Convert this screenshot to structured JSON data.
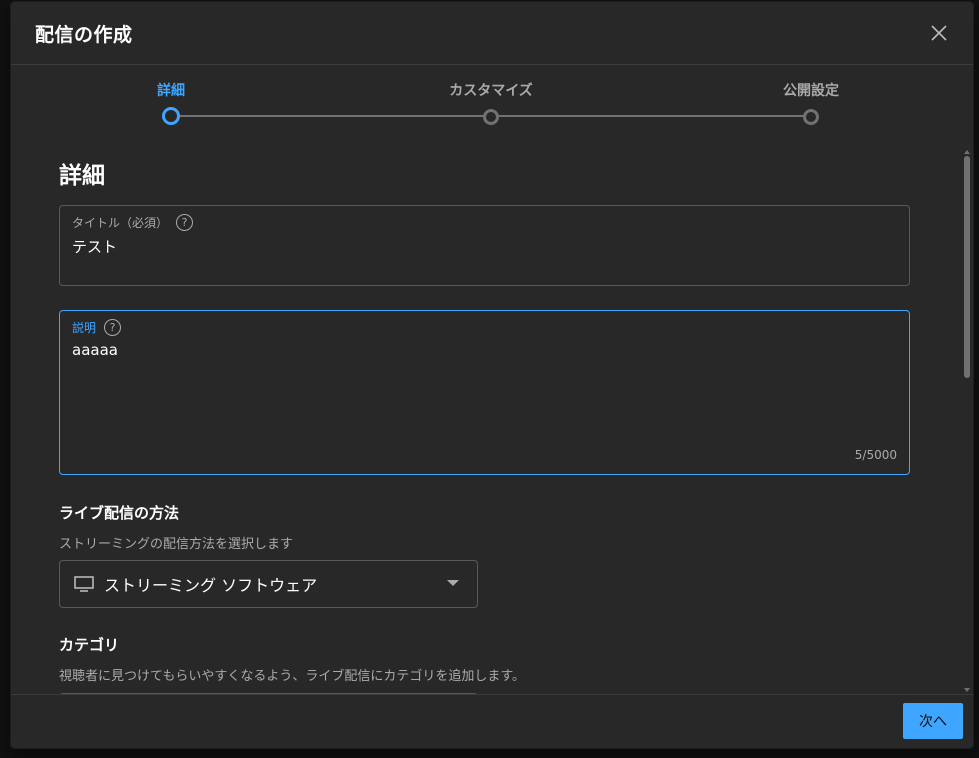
{
  "dialog": {
    "title": "配信の作成"
  },
  "stepper": {
    "steps": [
      {
        "label": "詳細",
        "active": true
      },
      {
        "label": "カスタマイズ",
        "active": false
      },
      {
        "label": "公開設定",
        "active": false
      }
    ]
  },
  "details": {
    "section_title": "詳細",
    "title_field": {
      "label": "タイトル（必須）",
      "value": "テスト"
    },
    "description_field": {
      "label": "説明",
      "value": "aaaaa",
      "char_count": "5/5000"
    },
    "help_glyph": "?"
  },
  "live_method": {
    "heading": "ライブ配信の方法",
    "description": "ストリーミングの配信方法を選択します",
    "selected": "ストリーミング ソフトウェア"
  },
  "category": {
    "heading": "カテゴリ",
    "description": "視聴者に見つけてもらいやすくなるよう、ライブ配信にカテゴリを追加します。"
  },
  "footer": {
    "next_label": "次へ"
  },
  "colors": {
    "accent": "#3ea6ff",
    "dialog_bg": "#282828",
    "border": "#595959"
  }
}
